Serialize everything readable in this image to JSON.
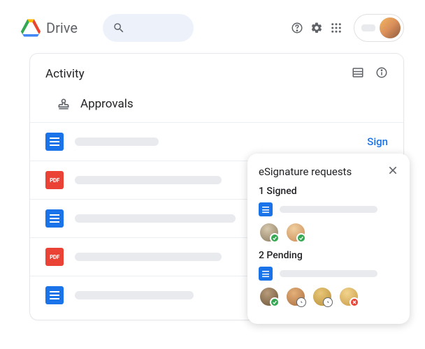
{
  "header": {
    "app_name": "Drive"
  },
  "card": {
    "title": "Activity",
    "section": "Approvals",
    "sign_label": "Sign",
    "rows": [
      {
        "type": "doc"
      },
      {
        "type": "pdf"
      },
      {
        "type": "doc"
      },
      {
        "type": "pdf"
      },
      {
        "type": "doc"
      }
    ]
  },
  "popup": {
    "title": "eSignature requests",
    "signed_label": "1 Signed",
    "pending_label": "2 Pending"
  },
  "pdf_label": "PDF"
}
